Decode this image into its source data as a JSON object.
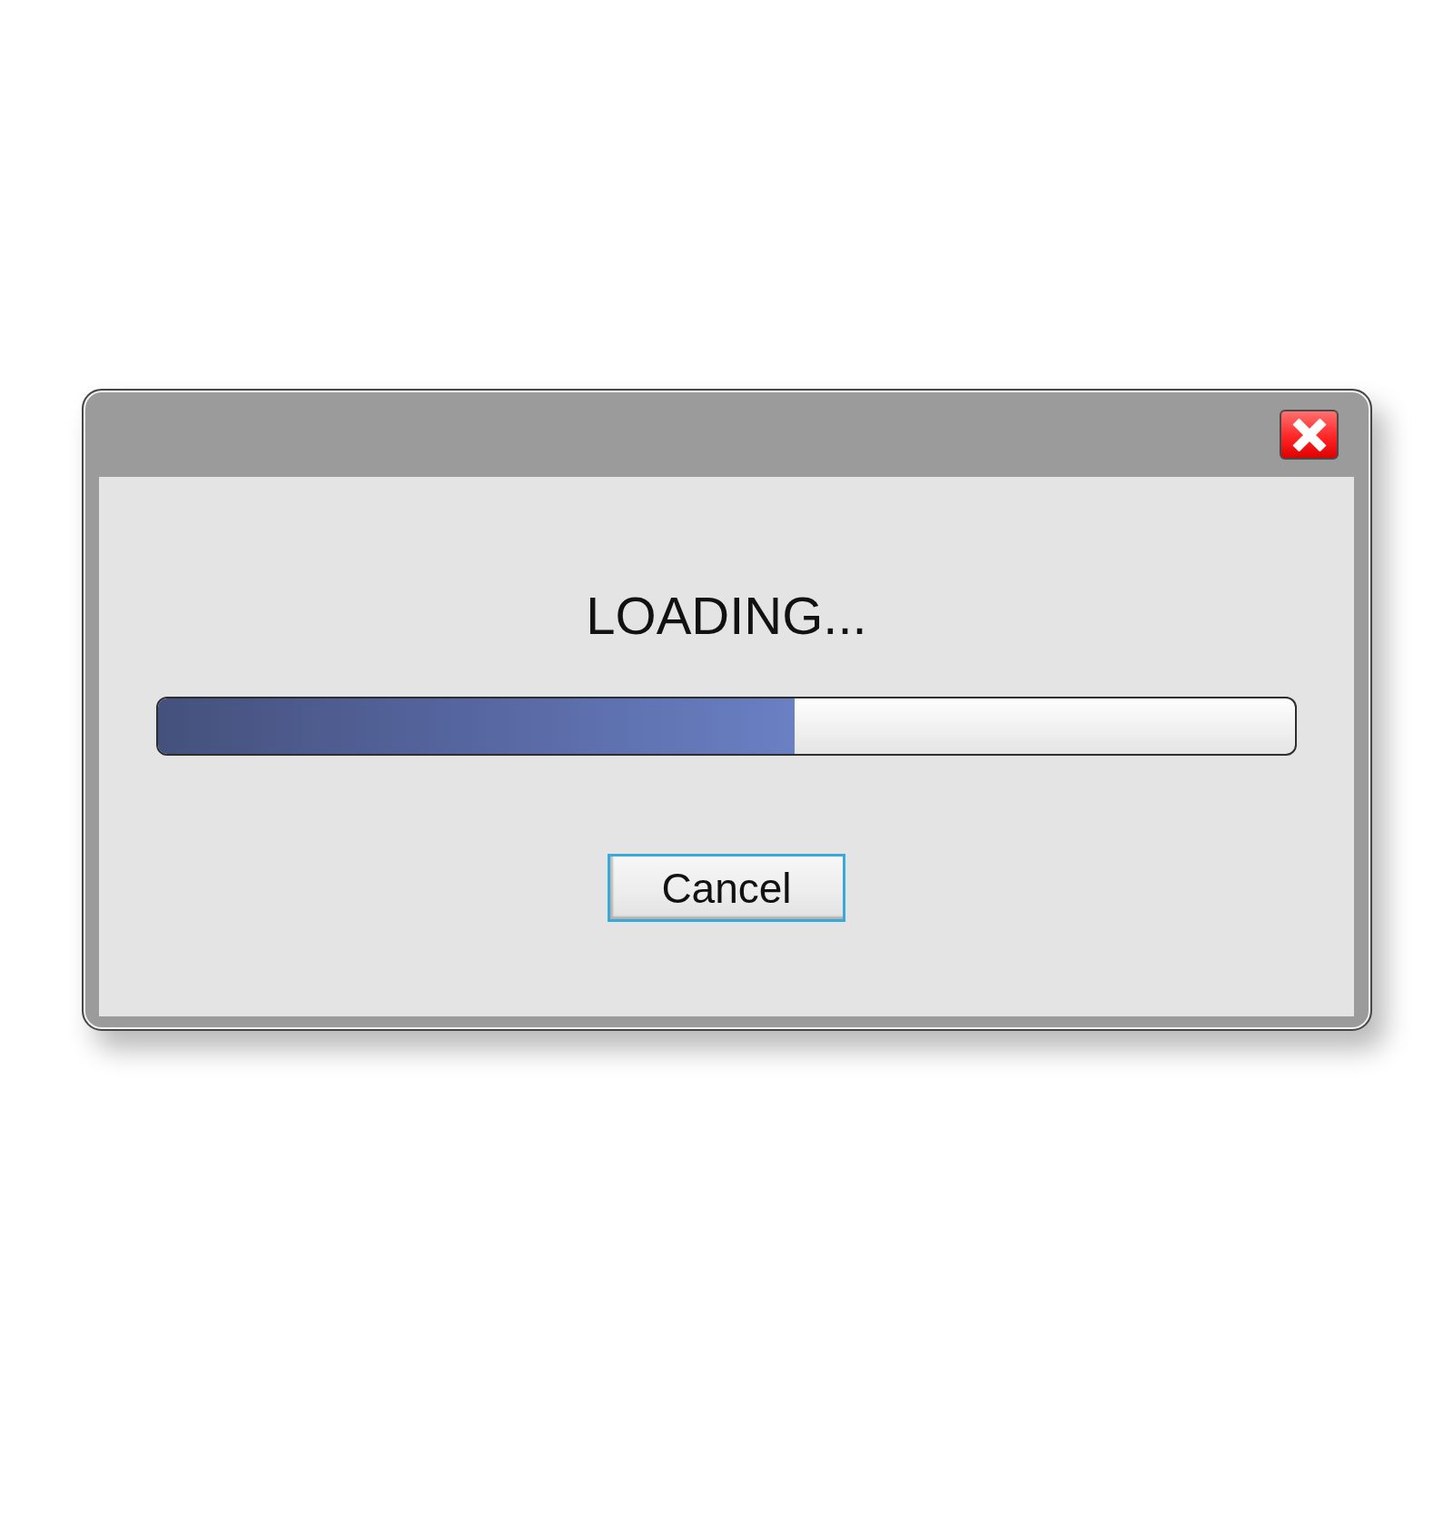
{
  "message": "LOADING...",
  "progress": {
    "level": 0.56
  },
  "buttons": [
    {
      "label": "Cancel",
      "focused": true
    }
  ]
}
